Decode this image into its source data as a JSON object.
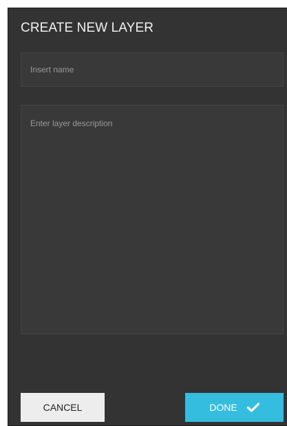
{
  "dialog": {
    "title": "CREATE NEW LAYER",
    "name_field": {
      "value": "",
      "placeholder": "Insert name"
    },
    "description_field": {
      "value": "",
      "placeholder": "Enter layer description"
    },
    "buttons": {
      "cancel_label": "CANCEL",
      "done_label": "DONE",
      "done_icon": "checkmark-icon"
    }
  },
  "colors": {
    "dialog_background": "#333333",
    "field_background": "#393939",
    "accent": "#35bde0",
    "cancel_background": "#ededed"
  }
}
